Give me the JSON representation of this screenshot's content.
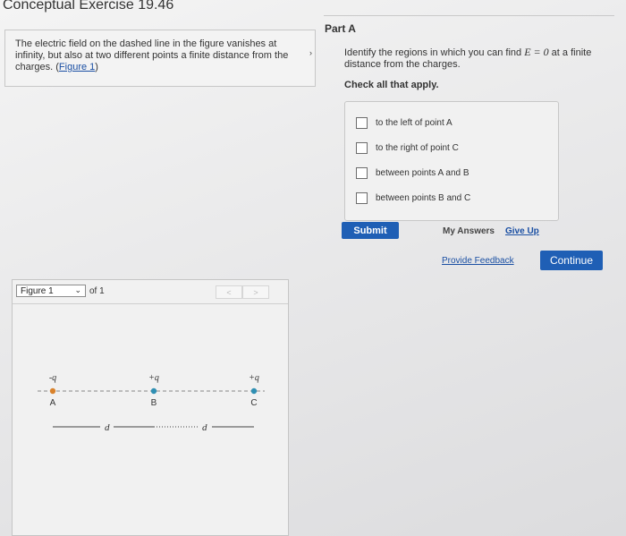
{
  "header": {
    "title": "Conceptual Exercise 19.46"
  },
  "problem": {
    "text": "The electric field on the dashed line in the figure vanishes at infinity, but also at two different points a finite distance from the charges. (",
    "figure_link": "Figure 1",
    "text_end": ")"
  },
  "part": {
    "label": "Part A",
    "question_pre": "Identify the regions in which you can find ",
    "question_math": "E = 0",
    "question_post": " at a finite distance from the charges.",
    "instruction": "Check all that apply.",
    "options": [
      {
        "label": "to the left of point A",
        "checked": false
      },
      {
        "label": "to the right of point C",
        "checked": false
      },
      {
        "label": "between points A and B",
        "checked": false
      },
      {
        "label": "between points B and C",
        "checked": false
      }
    ],
    "submit": "Submit",
    "my_answers": "My Answers",
    "give_up": "Give Up"
  },
  "footer": {
    "feedback": "Provide Feedback",
    "continue": "Continue"
  },
  "figure": {
    "selected": "Figure 1",
    "of_text": "of 1",
    "prev": "<",
    "next": ">",
    "charges": [
      {
        "sign_label": "-q",
        "point": "A",
        "color": "#d9822b"
      },
      {
        "sign_label": "+q",
        "point": "B",
        "color": "#2f8fb3"
      },
      {
        "sign_label": "+q",
        "point": "C",
        "color": "#2f8fb3"
      }
    ],
    "spacing_label": "d"
  },
  "colors": {
    "accent": "#1f5fb5",
    "link": "#1a4fa3"
  }
}
